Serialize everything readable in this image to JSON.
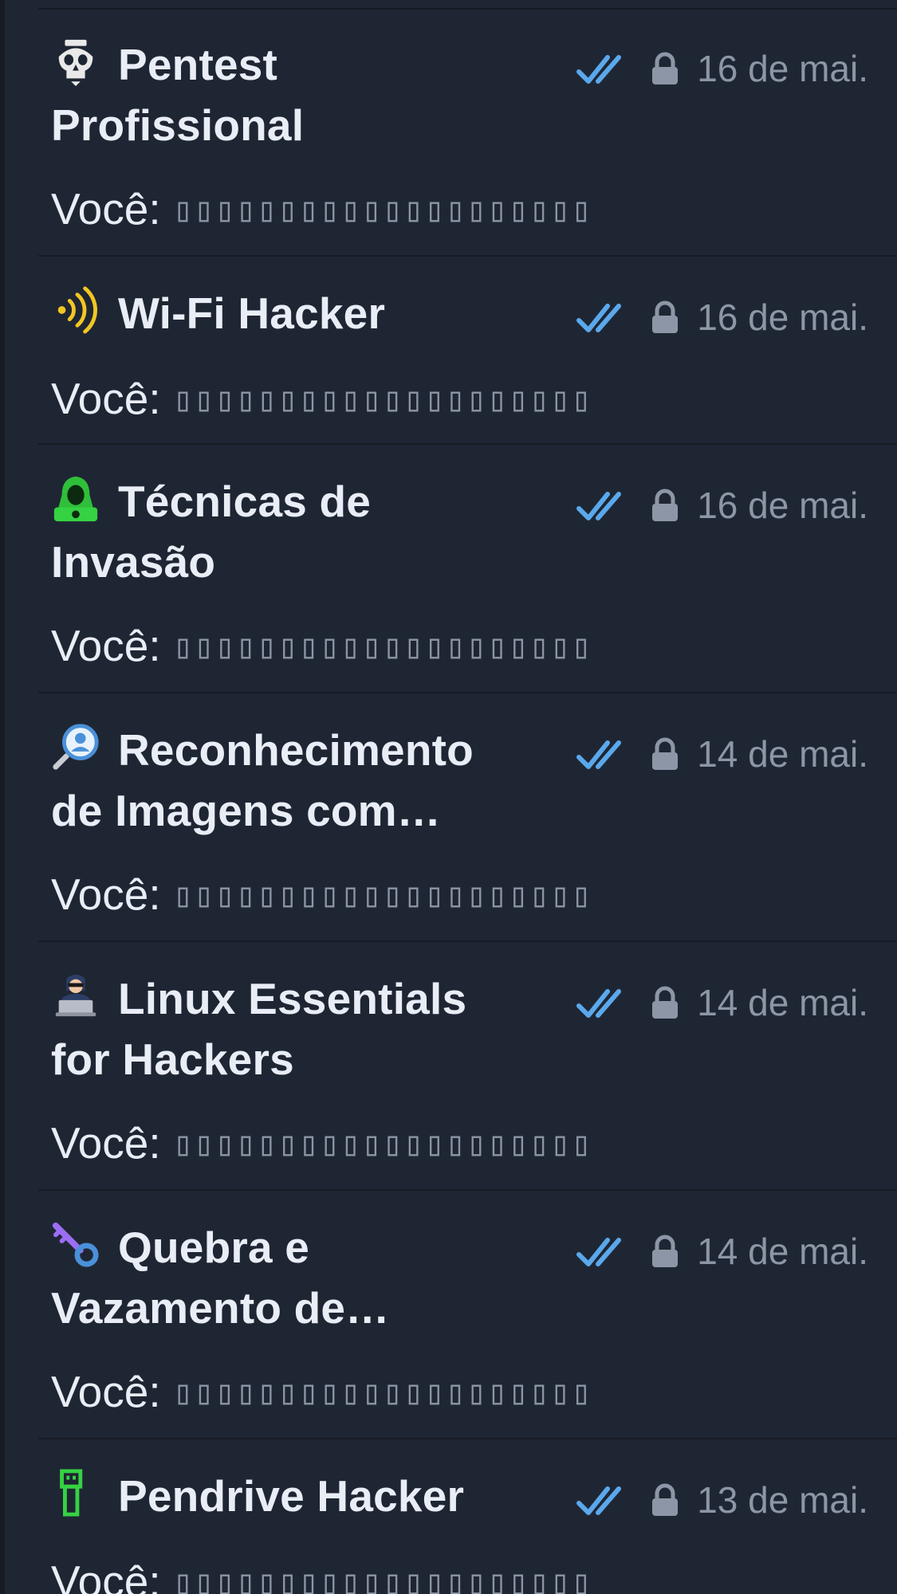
{
  "chats": [
    {
      "title": "Pentest Profissional",
      "icon": "skull-emoji-icon",
      "date": "16 de mai.",
      "preview_prefix": "Você:",
      "preview_body": "▯▯▯▯▯▯▯▯▯▯▯▯▯▯▯▯▯▯▯▯"
    },
    {
      "title": "Wi-Fi Hacker",
      "icon": "signal-emoji-icon",
      "date": "16 de mai.",
      "preview_prefix": "Você:",
      "preview_body": "▯▯▯▯▯▯▯▯▯▯▯▯▯▯▯▯▯▯▯▯"
    },
    {
      "title": "Técnicas de Invasão",
      "icon": "hooded-hacker-emoji-icon",
      "date": "16 de mai.",
      "preview_prefix": "Você:",
      "preview_body": "▯▯▯▯▯▯▯▯▯▯▯▯▯▯▯▯▯▯▯▯"
    },
    {
      "title": "Reconhecimento de Imagens com…",
      "icon": "magnifier-person-emoji-icon",
      "date": "14 de mai.",
      "preview_prefix": "Você:",
      "preview_body": "▯▯▯▯▯▯▯▯▯▯▯▯▯▯▯▯▯▯▯▯"
    },
    {
      "title": "Linux Essentials for Hackers",
      "icon": "hacker-laptop-emoji-icon",
      "date": "14 de mai.",
      "preview_prefix": "Você:",
      "preview_body": "▯▯▯▯▯▯▯▯▯▯▯▯▯▯▯▯▯▯▯▯"
    },
    {
      "title": "Quebra e Vazamento de…",
      "icon": "key-emoji-icon",
      "date": "14 de mai.",
      "preview_prefix": "Você:",
      "preview_body": "▯▯▯▯▯▯▯▯▯▯▯▯▯▯▯▯▯▯▯▯"
    },
    {
      "title": "Pendrive Hacker",
      "icon": "usb-drive-emoji-icon",
      "date": "13 de mai.",
      "preview_prefix": "Você:",
      "preview_body": "▯▯▯▯▯▯▯▯▯▯▯▯▯▯▯▯▯▯▯▯"
    }
  ],
  "status_icons": {
    "read": "double-check-icon",
    "secret": "lock-icon"
  },
  "colors": {
    "background": "#1f2633",
    "divider": "#161b24",
    "title": "#e8edf6",
    "date": "#8d96a6",
    "read_check": "#5aa8ec",
    "lock": "#8d96a6"
  }
}
